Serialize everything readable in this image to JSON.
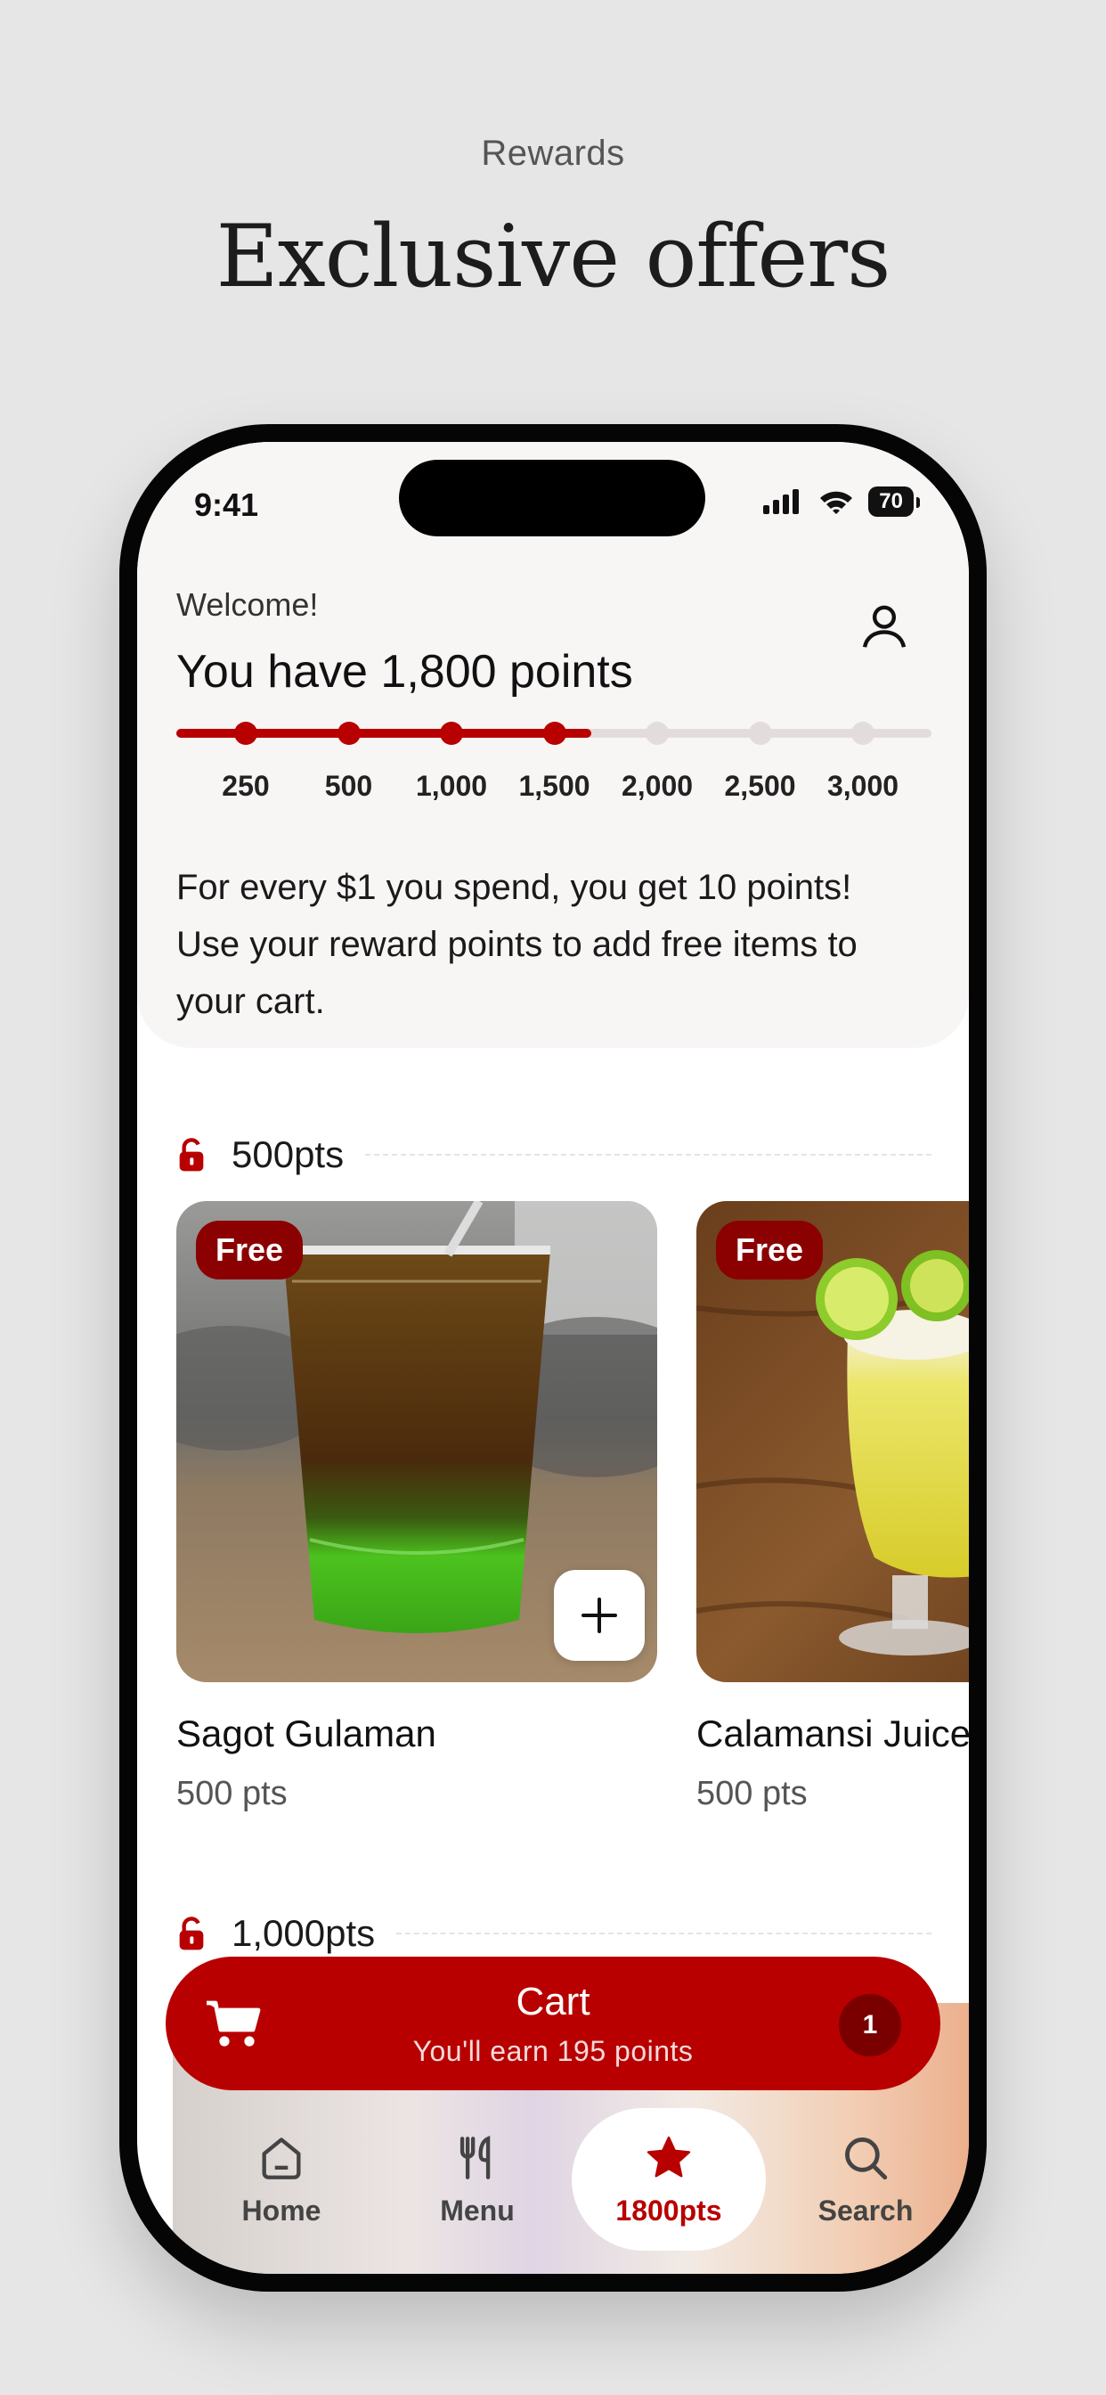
{
  "promo": {
    "eyebrow": "Rewards",
    "headline": "Exclusive offers"
  },
  "status_bar": {
    "time": "9:41",
    "battery": "70"
  },
  "header": {
    "welcome": "Welcome!",
    "points_title": "You have 1,800 points",
    "progress": {
      "current_points": 1800,
      "fraction_filled": 0.55,
      "milestones": [
        "250",
        "500",
        "1,000",
        "1,500",
        "2,000",
        "2,500",
        "3,000"
      ],
      "reached": [
        true,
        true,
        true,
        true,
        false,
        false,
        false
      ]
    },
    "description": "For every $1 you spend, you get 10 points! Use your reward points to add free items to your cart."
  },
  "sections": [
    {
      "label": "500pts"
    },
    {
      "label": "1,000pts"
    }
  ],
  "items": [
    {
      "name": "Sagot Gulaman",
      "points": "500 pts",
      "badge": "Free"
    },
    {
      "name": "Calamansi Juice",
      "points": "500 pts",
      "badge": "Free"
    }
  ],
  "cart": {
    "title": "Cart",
    "subtitle": "You'll earn 195 points",
    "count": "1"
  },
  "tabs": [
    {
      "label": "Home",
      "icon": "home-icon"
    },
    {
      "label": "Menu",
      "icon": "utensils-icon"
    },
    {
      "label": "1800pts",
      "icon": "star-icon",
      "active": true
    },
    {
      "label": "Search",
      "icon": "search-icon"
    }
  ],
  "colors": {
    "brand_red": "#b80000",
    "badge_dark_red": "#8b0000",
    "background": "#e6e6e6",
    "header_card": "#f8f5f5"
  }
}
